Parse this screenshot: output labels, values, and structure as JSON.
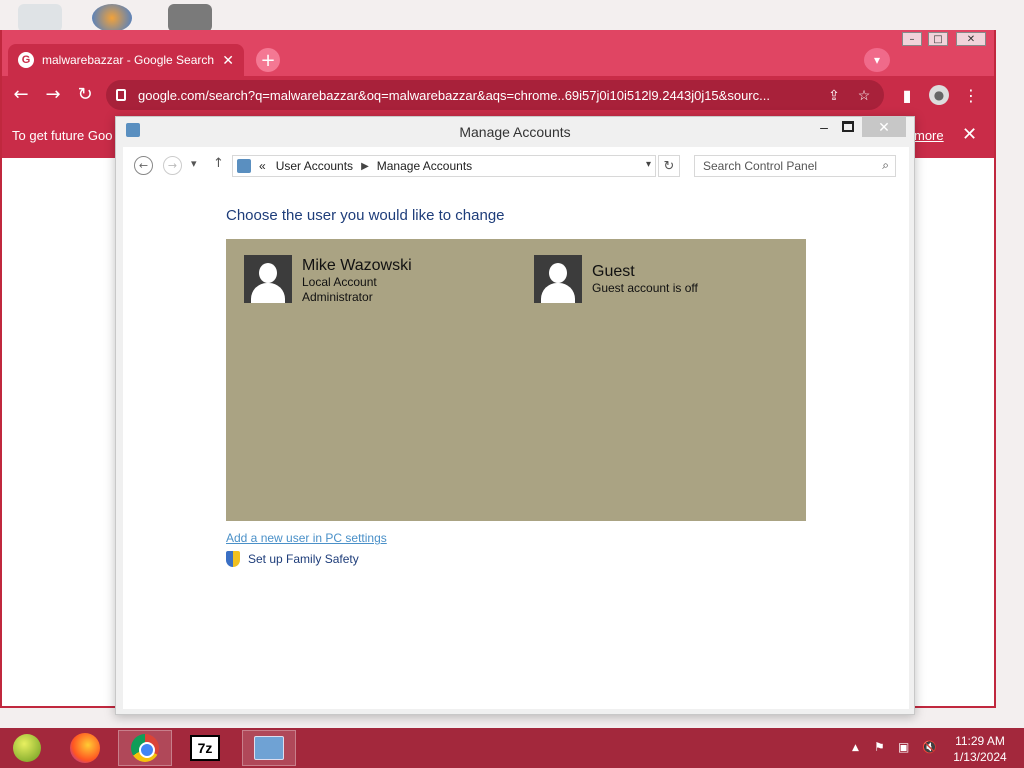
{
  "browser": {
    "tab_title": "malwarebazzar - Google Search",
    "url": "google.com/search?q=malwarebazzar&oq=malwarebazzar&aqs=chrome..69i57j0i10i512l9.2443j0j15&sourc...",
    "infobar_text": "To get future Goo",
    "infobar_link": "more",
    "new_tab_symbol": "+",
    "accent_color": "#c92c48"
  },
  "dialog": {
    "title": "Manage Accounts",
    "breadcrumb": {
      "prefix": "«",
      "items": [
        "User Accounts",
        "Manage Accounts"
      ]
    },
    "search_placeholder": "Search Control Panel",
    "heading": "Choose the user you would like to change",
    "accounts": [
      {
        "name": "Mike Wazowski",
        "line1": "Local Account",
        "line2": "Administrator"
      },
      {
        "name": "Guest",
        "line1": "Guest account is off",
        "line2": ""
      }
    ],
    "links": {
      "add_user": "Add a new user in PC settings",
      "family_safety": "Set up Family Safety"
    },
    "panel_color": "#aaa383"
  },
  "taskbar": {
    "time": "11:29 AM",
    "date": "1/13/2024",
    "sevenzip_label": "7z"
  }
}
